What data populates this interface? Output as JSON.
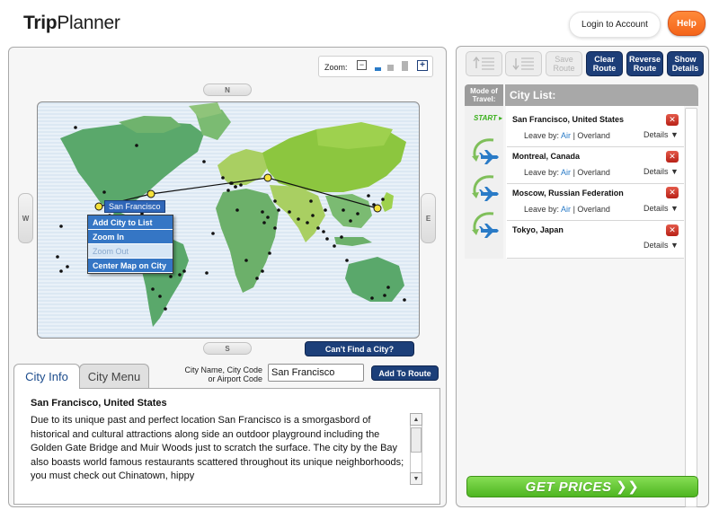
{
  "header": {
    "logo_bold": "Trip",
    "logo_regular": "Planner",
    "login_label": "Login to Account",
    "help_label": "Help"
  },
  "map_panel": {
    "zoom_label": "Zoom:",
    "compass": {
      "north": "N",
      "south": "S",
      "west": "W",
      "east": "E"
    },
    "selected_city_callout": "San Francisco",
    "context_menu": [
      "Add City to List",
      "Zoom In",
      "Zoom Out",
      "Center Map on City"
    ],
    "cant_find_label": "Can't Find a City?"
  },
  "city_search": {
    "tab_info": "City Info",
    "tab_menu": "City Menu",
    "field_label_1": "City Name, City Code",
    "field_label_2": "or Airport Code",
    "value": "San Francisco",
    "add_route_label": "Add To Route"
  },
  "city_info": {
    "title": "San Francisco, United States",
    "text": "Due to its unique past and perfect location San Francisco is a smorgasbord of historical and cultural attractions along side an outdoor playground including the Golden Gate Bridge and Muir Woods just to scratch the surface. The city by the Bay also boasts world famous restaurants scattered throughout its unique neighborhoods; you must check out Chinatown, hippy"
  },
  "toolbar": {
    "save_route_1": "Save",
    "save_route_2": "Route",
    "clear_route_1": "Clear",
    "clear_route_2": "Route",
    "reverse_route_1": "Reverse",
    "reverse_route_2": "Route",
    "show_details_1": "Show",
    "show_details_2": "Details"
  },
  "city_list": {
    "mode_header_1": "Mode of",
    "mode_header_2": "Travel:",
    "header": "City List:",
    "start_label": "START",
    "leave_by_label": "Leave by:",
    "air_label": "Air",
    "separator": "|",
    "overland_label": "Overland",
    "details_label": "Details",
    "items": [
      {
        "name": "San Francisco, United States"
      },
      {
        "name": "Montreal, Canada"
      },
      {
        "name": "Moscow, Russian Federation"
      },
      {
        "name": "Tokyo, Japan"
      }
    ]
  },
  "get_prices_label": "GET PRICES",
  "colors": {
    "accent_blue": "#1d3e78",
    "menu_blue": "#3576c5",
    "help_orange": "#f4651a",
    "prices_green": "#4eb521",
    "land_green": "#8cc63f"
  }
}
